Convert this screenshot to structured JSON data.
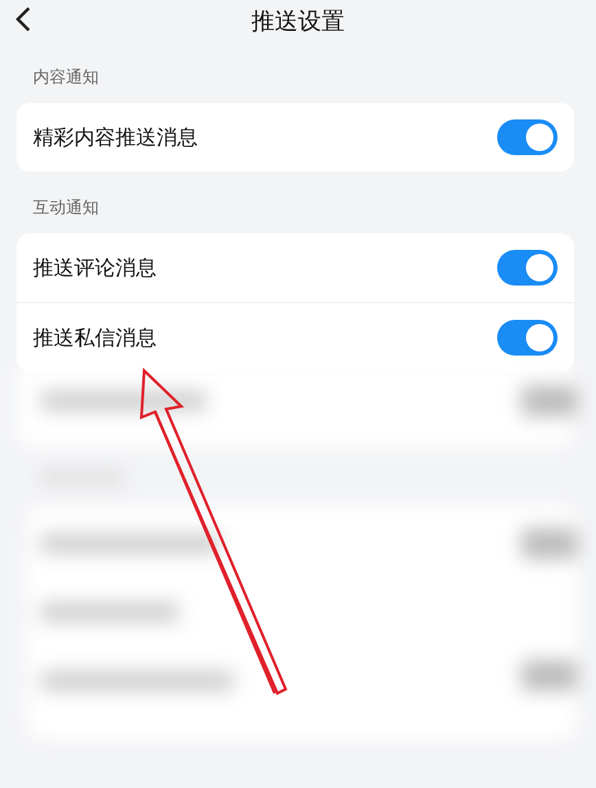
{
  "header": {
    "title": "推送设置"
  },
  "sections": [
    {
      "title": "内容通知",
      "items": [
        {
          "label": "精彩内容推送消息",
          "on": true
        }
      ]
    },
    {
      "title": "互动通知",
      "items": [
        {
          "label": "推送评论消息",
          "on": true
        },
        {
          "label": "推送私信消息",
          "on": true
        }
      ]
    }
  ]
}
